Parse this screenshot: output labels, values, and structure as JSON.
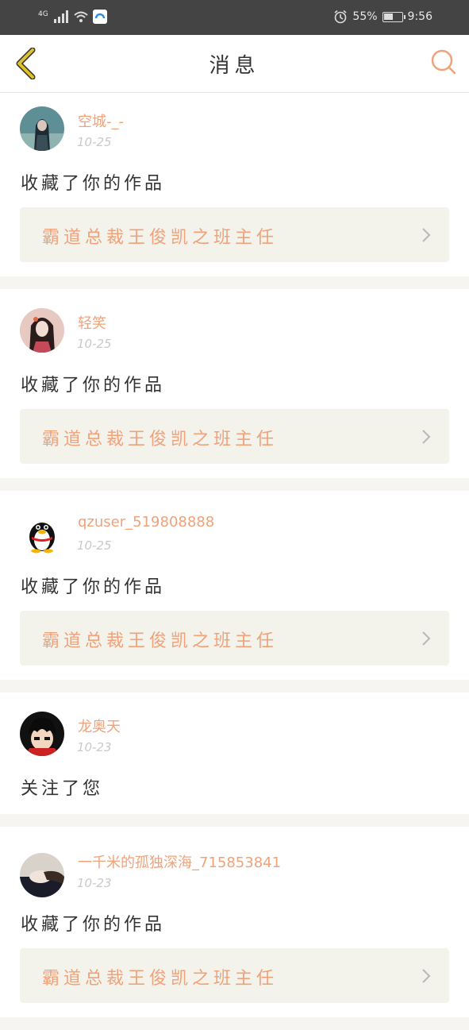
{
  "status_bar": {
    "network": "4G",
    "battery_percent": "55%",
    "battery_level": 0.55,
    "time": "9:56"
  },
  "nav": {
    "title": "消息",
    "back_icon": "chevron-left-icon",
    "search_icon": "search-icon",
    "accent_color": "#f0a27a",
    "back_color": "#e0c02a"
  },
  "messages": [
    {
      "username": "空城-_-",
      "date": "10-25",
      "action": "收藏了你的作品",
      "work_title": "霸道总裁王俊凯之班主任",
      "avatar": "avatar-girl-teal"
    },
    {
      "username": "轻笑",
      "date": "10-25",
      "action": "收藏了你的作品",
      "work_title": "霸道总裁王俊凯之班主任",
      "avatar": "avatar-girl-dark-hair"
    },
    {
      "username": "qzuser_519808888",
      "date": "10-25",
      "action": "收藏了你的作品",
      "work_title": "霸道总裁王俊凯之班主任",
      "avatar": "qq-penguin-avatar"
    },
    {
      "username": "龙奥天",
      "date": "10-23",
      "action": "关注了您",
      "work_title": "",
      "avatar": "avatar-boy-cartoon"
    },
    {
      "username": "一千米的孤独深海_715853841",
      "date": "10-23",
      "action": "收藏了你的作品",
      "work_title": "霸道总裁王俊凯之班主任",
      "avatar": "avatar-girl-lying"
    }
  ]
}
